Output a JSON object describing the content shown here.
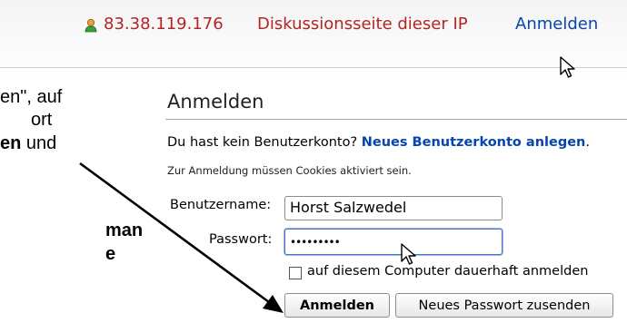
{
  "header": {
    "ip_address": "83.38.119.176",
    "talk_page_link": "Diskussionsseite dieser IP",
    "login_link": "Anmelden"
  },
  "instructions": {
    "line1": "en\", auf",
    "line2": "ort",
    "line3_bold": "en",
    "line3_rest": " und",
    "line4": "man",
    "line5": "e"
  },
  "login": {
    "title": "Anmelden",
    "no_account_text": "Du hast kein Benutzerkonto?",
    "create_account_link": "Neues Benutzerkonto anlegen",
    "create_account_suffix": ".",
    "cookies_note": "Zur Anmeldung müssen Cookies aktiviert sein.",
    "username_label": "Benutzername:",
    "username_value": "Horst Salzwedel",
    "password_label": "Passwort:",
    "password_value": "•••••••••",
    "remember_label": "auf diesem Computer dauerhaft anmelden",
    "remember_checked": false,
    "login_button": "Anmelden",
    "new_password_button": "Neues Passwort zusenden"
  },
  "colors": {
    "red_link": "#b32424",
    "blue_link": "#0645ad",
    "focus_border": "#4a73c9"
  }
}
